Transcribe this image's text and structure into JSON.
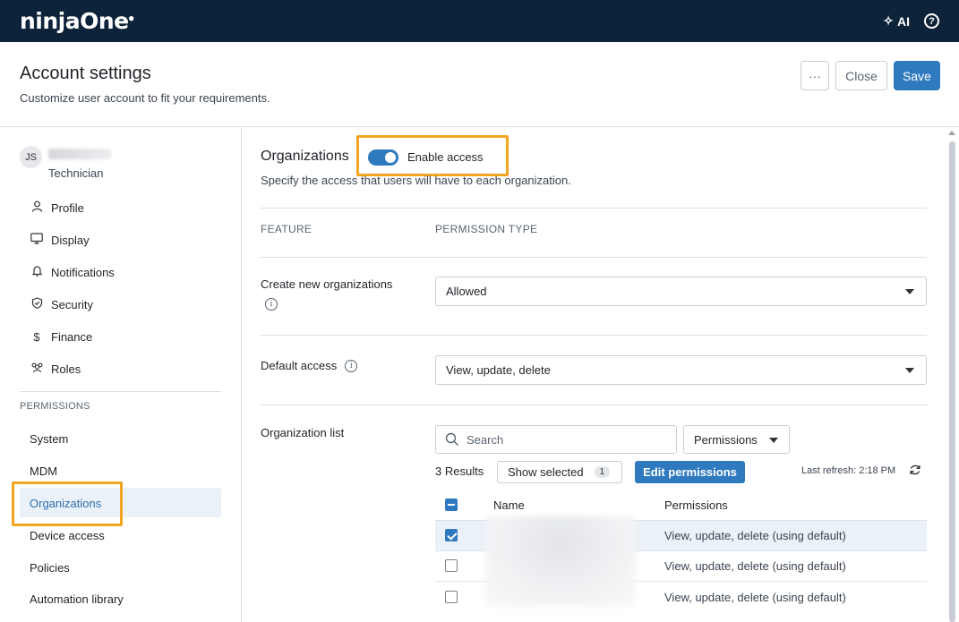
{
  "topbar": {
    "logo": "ninjaOne",
    "ai_label": "AI",
    "help": "?"
  },
  "header": {
    "title": "Account settings",
    "subtitle": "Customize user account to fit your requirements.",
    "more_label": "···",
    "close_label": "Close",
    "save_label": "Save"
  },
  "sidebar": {
    "user": {
      "initials": "JS",
      "role": "Technician"
    },
    "items": [
      {
        "label": "Profile",
        "icon": "person-icon"
      },
      {
        "label": "Display",
        "icon": "monitor-icon"
      },
      {
        "label": "Notifications",
        "icon": "bell-icon"
      },
      {
        "label": "Security",
        "icon": "shield-icon"
      },
      {
        "label": "Finance",
        "icon": "dollar-icon"
      },
      {
        "label": "Roles",
        "icon": "roles-icon"
      }
    ],
    "permissions_heading": "PERMISSIONS",
    "permissions": [
      "System",
      "MDM",
      "Organizations",
      "Device access",
      "Policies",
      "Automation library"
    ],
    "active_permission": "Organizations"
  },
  "main": {
    "section_title": "Organizations",
    "toggle_label": "Enable access",
    "toggle_on": true,
    "description": "Specify the access that users will have to each organization.",
    "col_feature": "FEATURE",
    "col_permission_type": "PERMISSION TYPE",
    "create_label": "Create new organizations",
    "create_value": "Allowed",
    "default_label": "Default access",
    "default_value": "View, update, delete",
    "org_list_label": "Organization list",
    "search_placeholder": "Search",
    "permissions_filter": "Permissions",
    "results": "3 Results",
    "show_selected": "Show selected",
    "selected_count": "1",
    "edit_permissions": "Edit permissions",
    "last_refresh": "Last refresh: 2:18 PM",
    "table": {
      "col_name": "Name",
      "col_permissions": "Permissions",
      "rows": [
        {
          "permissions": "View, update, delete (using default)",
          "checked": true
        },
        {
          "permissions": "View, update, delete (using default)",
          "checked": false
        },
        {
          "permissions": "View, update, delete (using default)",
          "checked": false
        }
      ]
    }
  },
  "colors": {
    "topbar": "#0d2339",
    "accent": "#2f7abf",
    "highlight": "#f3a521"
  }
}
